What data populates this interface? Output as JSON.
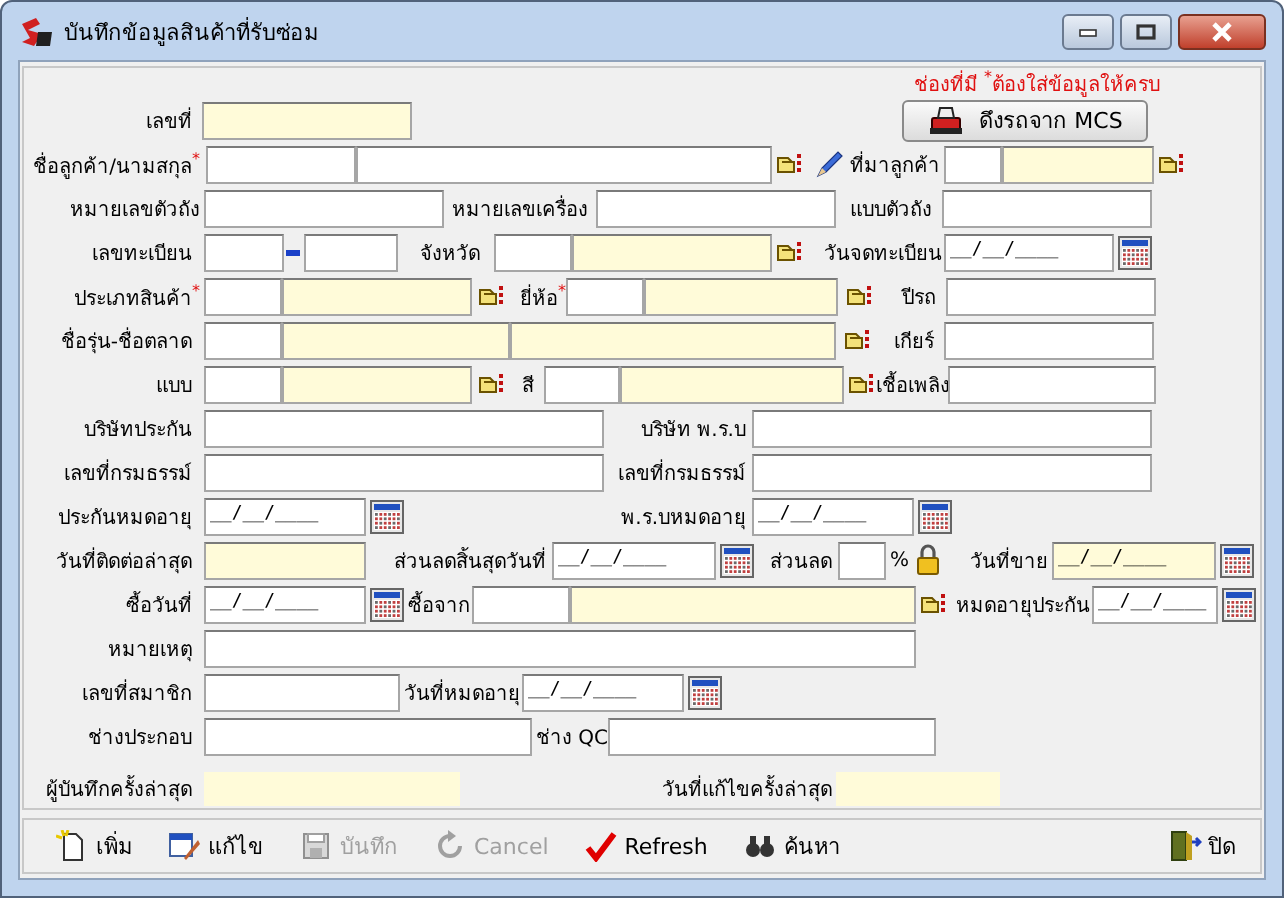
{
  "window": {
    "title": "บันทึกข้อมูลสินค้าที่รับซ่อม"
  },
  "notice": "ช่องที่มี $^{*}$ต้องใส่ข้อมูลให้ครบ",
  "rows": [
    {
      "items": [
        {
          "kind": "label",
          "text": "เลขที่"
        },
        {
          "kind": "input",
          "segments": [
            {
              "readonly": true
            }
          ]
        },
        {
          "kind": "button",
          "text": "ดึงรถจาก MCS"
        }
      ]
    },
    {
      "items": [
        {
          "kind": "label",
          "text": "ชื่อลูกค้า/นามสกุล$^{*}$"
        },
        {
          "kind": "input",
          "segments": [
            {
              "readonly": false
            },
            {
              "readonly": false
            }
          ]
        },
        {
          "kind": "lookup"
        },
        {
          "kind": "pencil"
        },
        {
          "kind": "label",
          "text": "ที่มาลูกค้า"
        },
        {
          "kind": "input",
          "segments": [
            {
              "readonly": false
            },
            {
              "readonly": true
            }
          ]
        },
        {
          "kind": "lookup"
        }
      ]
    },
    {
      "items": [
        {
          "kind": "label",
          "text": "หมายเลขตัวถัง"
        },
        {
          "kind": "input",
          "segments": [
            {
              "readonly": false
            }
          ]
        },
        {
          "kind": "label",
          "text": "หมายเลขเครื่อง"
        },
        {
          "kind": "input",
          "segments": [
            {
              "readonly": false
            }
          ]
        },
        {
          "kind": "label",
          "text": "แบบตัวถัง"
        },
        {
          "kind": "input",
          "segments": [
            {
              "readonly": false
            }
          ]
        }
      ]
    },
    {
      "items": [
        {
          "kind": "label",
          "text": "เลขทะเบียน"
        },
        {
          "kind": "input",
          "segments": [
            {
              "readonly": false
            }
          ]
        },
        {
          "kind": "separator"
        },
        {
          "kind": "input",
          "segments": [
            {
              "readonly": false
            }
          ]
        },
        {
          "kind": "label",
          "text": "จังหวัด"
        },
        {
          "kind": "input",
          "segments": [
            {
              "readonly": false
            },
            {
              "readonly": true
            }
          ]
        },
        {
          "kind": "lookup"
        },
        {
          "kind": "label",
          "text": "วันจดทะเบียน"
        },
        {
          "kind": "date",
          "value": "__/__/____",
          "readonly": false
        },
        {
          "kind": "calendar"
        }
      ]
    },
    {
      "items": [
        {
          "kind": "label",
          "text": "ประเภทสินค้า$^{*}$"
        },
        {
          "kind": "input",
          "segments": [
            {
              "readonly": false
            },
            {
              "readonly": true
            }
          ]
        },
        {
          "kind": "lookup"
        },
        {
          "kind": "label",
          "text": "ยี่ห้อ$^{*}$"
        },
        {
          "kind": "input",
          "segments": [
            {
              "readonly": false
            },
            {
              "readonly": true
            }
          ]
        },
        {
          "kind": "lookup"
        },
        {
          "kind": "label",
          "text": "ปีรถ"
        },
        {
          "kind": "input",
          "segments": [
            {
              "readonly": false
            }
          ]
        }
      ]
    },
    {
      "items": [
        {
          "kind": "label",
          "text": "ชื่อรุ่น-ชื่อตลาด"
        },
        {
          "kind": "input",
          "segments": [
            {
              "readonly": false
            },
            {
              "readonly": true
            },
            {
              "readonly": true
            }
          ]
        },
        {
          "kind": "lookup"
        },
        {
          "kind": "label",
          "text": "เกียร์"
        },
        {
          "kind": "input",
          "segments": [
            {
              "readonly": false
            }
          ]
        }
      ]
    },
    {
      "items": [
        {
          "kind": "label",
          "text": "แบบ"
        },
        {
          "kind": "input",
          "segments": [
            {
              "readonly": false
            },
            {
              "readonly": true
            }
          ]
        },
        {
          "kind": "lookup"
        },
        {
          "kind": "label",
          "text": "สี"
        },
        {
          "kind": "input",
          "segments": [
            {
              "readonly": false
            },
            {
              "readonly": true
            }
          ]
        },
        {
          "kind": "lookup"
        },
        {
          "kind": "label",
          "text": "เชื้อเพลิง"
        },
        {
          "kind": "input",
          "segments": [
            {
              "readonly": false
            }
          ]
        }
      ]
    },
    {
      "items": [
        {
          "kind": "label",
          "text": "บริษัทประกัน"
        },
        {
          "kind": "input",
          "segments": [
            {
              "readonly": false
            }
          ]
        },
        {
          "kind": "label",
          "text": "บริษัท พ.ร.บ"
        },
        {
          "kind": "input",
          "segments": [
            {
              "readonly": false
            }
          ]
        }
      ]
    },
    {
      "items": [
        {
          "kind": "label",
          "text": "เลขที่กรมธรรม์"
        },
        {
          "kind": "input",
          "segments": [
            {
              "readonly": false
            }
          ]
        },
        {
          "kind": "label",
          "text": "เลขที่กรมธรรม์"
        },
        {
          "kind": "input",
          "segments": [
            {
              "readonly": false
            }
          ]
        }
      ]
    },
    {
      "items": [
        {
          "kind": "label",
          "text": "ประกันหมดอายุ"
        },
        {
          "kind": "date",
          "value": "__/__/____",
          "readonly": false
        },
        {
          "kind": "calendar"
        },
        {
          "kind": "label",
          "text": "พ.ร.บหมดอายุ"
        },
        {
          "kind": "date",
          "value": "__/__/____",
          "readonly": false
        },
        {
          "kind": "calendar"
        }
      ]
    },
    {
      "items": [
        {
          "kind": "label",
          "text": "วันที่ติดต่อล่าสุด"
        },
        {
          "kind": "input",
          "segments": [
            {
              "readonly": true
            }
          ]
        },
        {
          "kind": "label",
          "text": "ส่วนลดสิ้นสุดวันที่"
        },
        {
          "kind": "date",
          "value": "__/__/____",
          "readonly": false
        },
        {
          "kind": "calendar"
        },
        {
          "kind": "label",
          "text": "ส่วนลด"
        },
        {
          "kind": "input",
          "segments": [
            {
              "readonly": false
            }
          ]
        },
        {
          "kind": "label",
          "text": "%"
        },
        {
          "kind": "lock"
        },
        {
          "kind": "label",
          "text": "วันที่ขาย"
        },
        {
          "kind": "date",
          "value": "__/__/____",
          "readonly": true
        },
        {
          "kind": "calendar"
        }
      ]
    },
    {
      "items": [
        {
          "kind": "label",
          "text": "ซื้อวันที่"
        },
        {
          "kind": "date",
          "value": "__/__/____",
          "readonly": false
        },
        {
          "kind": "calendar"
        },
        {
          "kind": "label",
          "text": "ซื้อจาก"
        },
        {
          "kind": "input",
          "segments": [
            {
              "readonly": false
            },
            {
              "readonly": true
            }
          ]
        },
        {
          "kind": "lookup"
        },
        {
          "kind": "label",
          "text": "หมดอายุประกัน"
        },
        {
          "kind": "date",
          "value": "__/__/____",
          "readonly": false
        },
        {
          "kind": "calendar"
        }
      ]
    },
    {
      "items": [
        {
          "kind": "label",
          "text": "หมายเหตุ"
        },
        {
          "kind": "input",
          "segments": [
            {
              "readonly": false
            }
          ]
        }
      ]
    },
    {
      "items": [
        {
          "kind": "label",
          "text": "เลขที่สมาชิก"
        },
        {
          "kind": "input",
          "segments": [
            {
              "readonly": false
            }
          ]
        },
        {
          "kind": "label",
          "text": "วันที่หมดอายุ"
        },
        {
          "kind": "date",
          "value": "__/__/____",
          "readonly": false
        },
        {
          "kind": "calendar"
        }
      ]
    },
    {
      "items": [
        {
          "kind": "label",
          "text": "ช่างประกอบ"
        },
        {
          "kind": "input",
          "segments": [
            {
              "readonly": false
            }
          ]
        },
        {
          "kind": "label",
          "text": "ช่าง QC"
        },
        {
          "kind": "input",
          "segments": [
            {
              "readonly": false
            }
          ]
        }
      ]
    },
    {
      "items": [
        {
          "kind": "label",
          "text": "ผู้บันทึกครั้งล่าสุด"
        },
        {
          "kind": "display"
        },
        {
          "kind": "label",
          "text": "วันที่แก้ไขครั้งล่าสุด"
        },
        {
          "kind": "display"
        }
      ]
    }
  ],
  "toolbar": [
    {
      "kind": "new",
      "text": "เพิ่ม",
      "disabled": false
    },
    {
      "kind": "edit",
      "text": "แก้ไข",
      "disabled": false
    },
    {
      "kind": "save",
      "text": "บันทึก",
      "disabled": true
    },
    {
      "kind": "cancel",
      "text": "Cancel",
      "disabled": true
    },
    {
      "kind": "refresh",
      "text": "Refresh",
      "disabled": false
    },
    {
      "kind": "search",
      "text": "ค้นหา",
      "disabled": false
    },
    {
      "kind": "close",
      "text": "ปิด",
      "disabled": false
    }
  ]
}
